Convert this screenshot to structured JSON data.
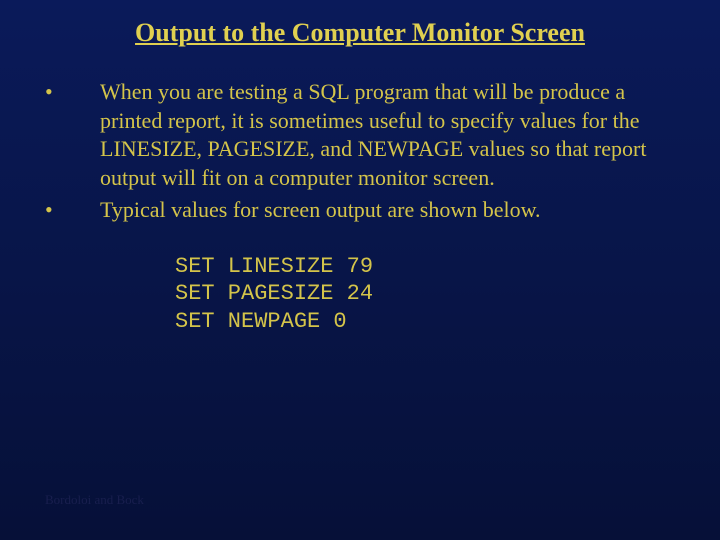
{
  "title": "Output to the Computer Monitor Screen",
  "bullets": [
    {
      "marker": "•",
      "text": "When you are testing a SQL program that will be produce a printed report, it is sometimes useful to specify values for the LINESIZE, PAGESIZE, and NEWPAGE values so that report output will fit on a computer monitor screen."
    },
    {
      "marker": "•",
      "text": "Typical values for screen output are shown below."
    }
  ],
  "code": {
    "line1": "SET LINESIZE 79",
    "line2": "SET PAGESIZE 24",
    "line3": "SET NEWPAGE 0"
  },
  "footer": "Bordoloi and Bock"
}
